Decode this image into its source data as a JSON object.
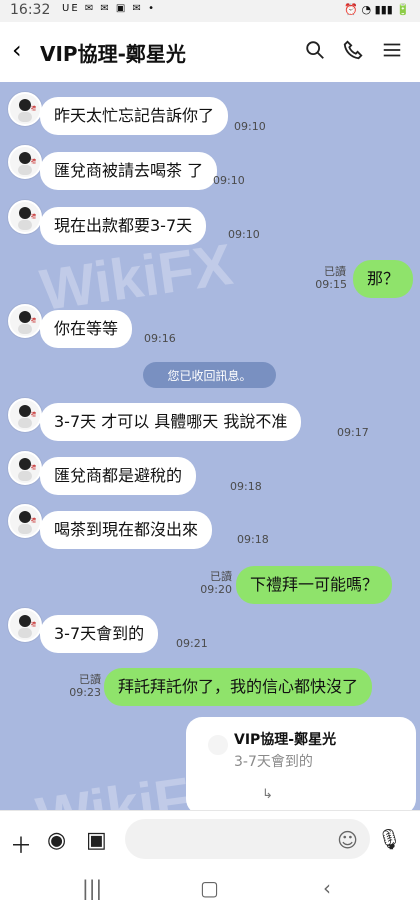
{
  "status": {
    "time": "16:32",
    "left_icons": "UE ✉ ✉ ▣ ✉ •",
    "right_icons": "⏰ ◔ ▮▮▮ 🔋"
  },
  "header": {
    "title": "VIP協理-鄭星光"
  },
  "messages": [
    {
      "side": "left",
      "text": "昨天太忙忘記告訴你了",
      "time": "09:10"
    },
    {
      "side": "left",
      "text": "匯兌商被請去喝茶 了",
      "time": "09:10"
    },
    {
      "side": "left",
      "text": "現在出款都要3-7天",
      "time": "09:10"
    },
    {
      "side": "right",
      "text": "那？",
      "read": "已讀",
      "time": "09:15"
    },
    {
      "side": "left",
      "text": "你在等等",
      "time": "09:16"
    },
    {
      "side": "notice",
      "text": "您已收回訊息。"
    },
    {
      "side": "left",
      "text": "3-7天 才可以 具體哪天 我說不准",
      "time": "09:17"
    },
    {
      "side": "left",
      "text": "匯兌商都是避稅的",
      "time": "09:18"
    },
    {
      "side": "left",
      "text": "喝茶到現在都沒出來",
      "time": "09:18"
    },
    {
      "side": "right",
      "text": "下禮拜一可能嗎？",
      "read": "已讀",
      "time": "09:20"
    },
    {
      "side": "left",
      "text": "3-7天會到的",
      "time": "09:21"
    },
    {
      "side": "right",
      "text": "拜託拜託你了，我的信心都快沒了",
      "read": "已讀",
      "time": "09:23"
    }
  ],
  "quote": {
    "name": "VIP協理-鄭星光",
    "text": "3-7天會到的"
  },
  "watermark": "WikiFX",
  "input": {
    "placeholder": ""
  }
}
